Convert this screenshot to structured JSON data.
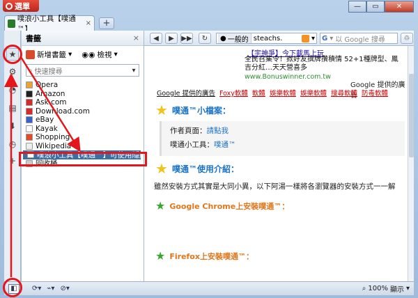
{
  "window": {
    "menu_label": "選單",
    "tab_title": "噗浪小工具【噗通™】",
    "tab_close": "×",
    "new_tab": "+",
    "min": "—",
    "max": "▭",
    "close": "✕"
  },
  "panel": {
    "title": "書籤",
    "close": "×",
    "new_bookmark": "新增書籤",
    "view": "檢視",
    "search_placeholder": "快速搜尋",
    "items": [
      {
        "label": "Opera",
        "color": "#e8a33a"
      },
      {
        "label": "Amazon",
        "color": "#222222"
      },
      {
        "label": "Ask.com",
        "color": "#d62b2b"
      },
      {
        "label": "Download.com",
        "color": "#d62b2b"
      },
      {
        "label": "eBay",
        "color": "#3a63c9"
      },
      {
        "label": "Kayak",
        "color": "#ffffff"
      },
      {
        "label": "Shopping",
        "color": "#e24b2c"
      },
      {
        "label": "Wikipedia",
        "color": "#eeeeee"
      },
      {
        "label": "噗浪小工具【噗通™】可使用隱藏版…",
        "color": "#ffffff"
      },
      {
        "label": "回收桶",
        "color": "#cccccc"
      }
    ]
  },
  "nav": {
    "back": "◀",
    "forward": "▶",
    "fast_forward": "▶▶",
    "reload": "↻",
    "mode_label": "一般的",
    "address": "steachs.",
    "search_engine": "G",
    "search_placeholder": "以 Google 搜尋",
    "trash": "♲"
  },
  "content": {
    "ad_title": "【宇神爭】今下載馬上玩",
    "ad_text": "全民召集令！掀好友撰牌攢積情 52+1種牌型、鳳吉分紅…天天營喜多",
    "ad_url": "www.Bonuswinner.com.tw",
    "ad_google": "Google 提供的廣告",
    "ad_links_head": "Google 提供的廣告",
    "ad_links": [
      "Foxy軟體",
      "軟體",
      "娛樂軟體",
      "娛樂軟體",
      "搜尋軟體",
      "防毒軟體"
    ],
    "section1": "噗通™小檔案：",
    "author_label": "作者頁面：",
    "author_link": "請點我",
    "tool_label": "噗通小工具：",
    "tool_link": "噗通™",
    "section2": "噗通™使用介紹：",
    "intro": "雖然安裝方式其實是大同小異，以下阿湯一樣將各瀏覽器的安裝方式一一解",
    "chrome_heading": "Google Chrome上安裝噗通™：",
    "firefox_heading": "Firefox上安裝噗通™："
  },
  "status": {
    "zoom": "100%",
    "display": "顯示"
  },
  "colors": {
    "annotation": "#e3161b",
    "link": "#1c74c4",
    "accent_orange": "#e1761a"
  }
}
